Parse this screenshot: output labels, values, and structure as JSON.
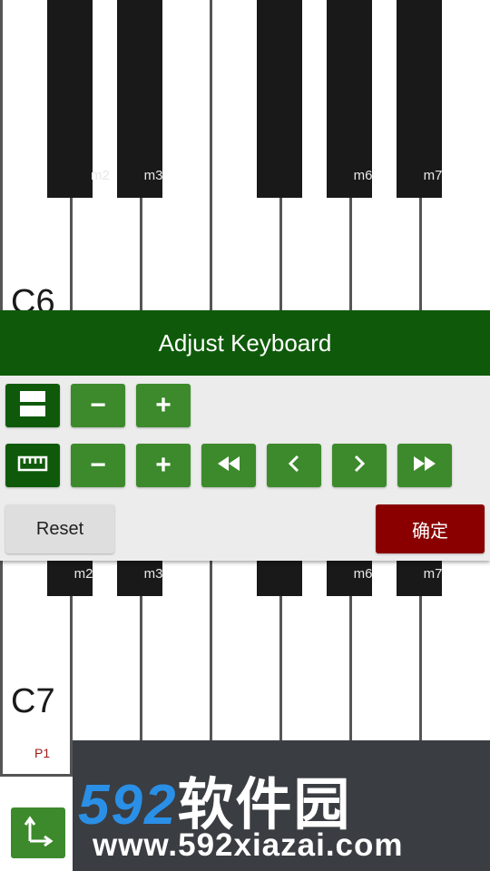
{
  "upper_keyboard": {
    "octave_label": "C6",
    "black_keys": [
      "m2",
      "m3",
      "",
      "m6",
      "m7"
    ]
  },
  "panel": {
    "title": "Adjust Keyboard",
    "row1": {
      "mode_icon": "rows-icon",
      "minus": "−",
      "plus": "+"
    },
    "row2": {
      "mode_icon": "ruler-icon",
      "minus": "−",
      "plus": "+",
      "fast_back": "⏪",
      "back": "‹",
      "forward": "›",
      "fast_forward": "⏩"
    },
    "reset_label": "Reset",
    "confirm_label": "确定"
  },
  "lower_keyboard": {
    "octave_label": "C7",
    "p_label": "P1",
    "black_keys": [
      "m2",
      "m3",
      "",
      "m6",
      "m7"
    ]
  },
  "watermark": {
    "brand_digits": "592",
    "brand_text": "软件园",
    "url": "www.592xiazai.com"
  },
  "colors": {
    "header": "#0f5a0a",
    "button": "#3c8a2b",
    "confirm": "#8a0000"
  }
}
